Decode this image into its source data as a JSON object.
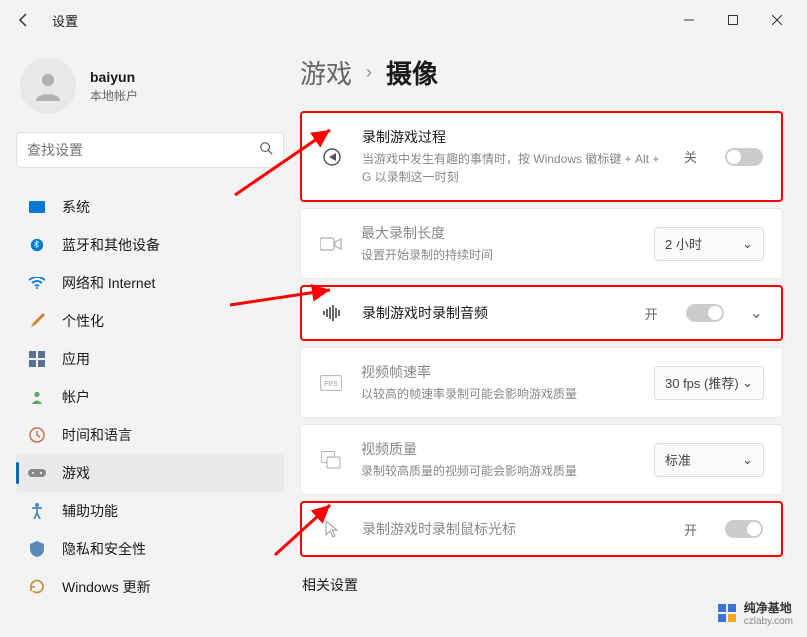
{
  "window": {
    "title": "设置",
    "min": "−",
    "max": "☐",
    "close": "✕"
  },
  "profile": {
    "name": "baiyun",
    "sub": "本地帐户"
  },
  "search": {
    "placeholder": "查找设置"
  },
  "nav": {
    "system": "系统",
    "bluetooth": "蓝牙和其他设备",
    "network": "网络和 Internet",
    "personalization": "个性化",
    "apps": "应用",
    "accounts": "帐户",
    "time": "时间和语言",
    "gaming": "游戏",
    "accessibility": "辅助功能",
    "privacy": "隐私和安全性",
    "update": "Windows 更新"
  },
  "breadcrumb": {
    "main": "游戏",
    "sub": "摄像"
  },
  "cards": {
    "record_process": {
      "title": "录制游戏过程",
      "desc": "当游戏中发生有趣的事情时，按 Windows 徽标键 + Alt + G 以录制这一时刻",
      "state": "关"
    },
    "max_length": {
      "title": "最大录制长度",
      "desc": "设置开始录制的持续时间",
      "value": "2 小时"
    },
    "record_audio": {
      "title": "录制游戏时录制音频",
      "state": "开"
    },
    "fps": {
      "title": "视频帧速率",
      "desc": "以较高的帧速率录制可能会影响游戏质量",
      "value": "30 fps (推荐)"
    },
    "quality": {
      "title": "视频质量",
      "desc": "录制较高质量的视频可能会影响游戏质量",
      "value": "标准"
    },
    "cursor": {
      "title": "录制游戏时录制鼠标光标",
      "state": "开"
    }
  },
  "related": "相关设置",
  "watermark": {
    "name": "纯净基地",
    "url": "czlaby.com"
  }
}
